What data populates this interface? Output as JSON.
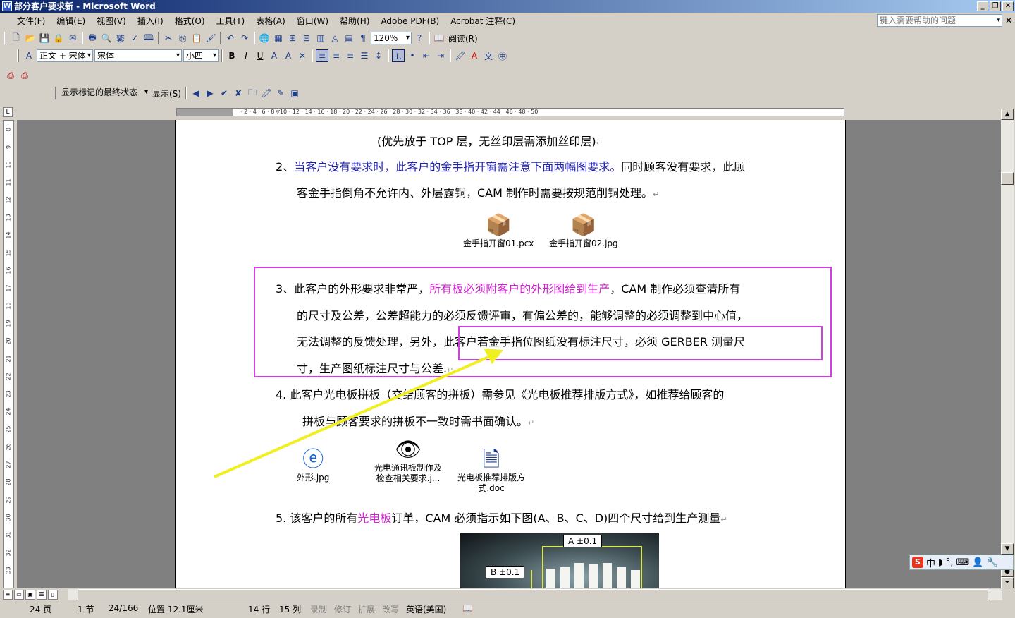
{
  "window": {
    "title": "部分客户要求新 - Microsoft Word"
  },
  "menu": {
    "items": [
      "文件(F)",
      "编辑(E)",
      "视图(V)",
      "插入(I)",
      "格式(O)",
      "工具(T)",
      "表格(A)",
      "窗口(W)",
      "帮助(H)",
      "Adobe PDF(B)",
      "Acrobat 注释(C)"
    ],
    "help_placeholder": "键入需要帮助的问题"
  },
  "toolbar": {
    "zoom": "120%",
    "read_label": "阅读(R)",
    "style": "正文 + 宋体",
    "font": "宋体",
    "size": "小四",
    "bold": "B",
    "italic": "I",
    "underline": "U",
    "font_color_label": "A",
    "review_state": "显示标记的最终状态",
    "show_label": "显示(S)"
  },
  "document": {
    "line_top": "(优先放于 TOP 层，无丝印层需添加丝印层)",
    "p2_num": "2、",
    "p2_blue": "当客户没有要求时，此客户的金手指开窗需注意下面两幅图要求。",
    "p2_rest": "同时顾客没有要求，此顾",
    "p2_line2": "客金手指倒角不允许内、外层露铜，CAM 制作时需要按规范削铜处理。",
    "attach1": "金手指开窗01.pcx",
    "attach2": "金手指开窗02.jpg",
    "p3_num": "3、",
    "p3_a": "此客户的外形要求非常严，",
    "p3_magenta": "所有板必须附客户的外形图给到生产",
    "p3_b": "，CAM 制作必须查清所有",
    "p3_line2": "的尺寸及公差，公差超能力的必须反馈评审，有偏公差的，能够调整的必须调整到中心值，",
    "p3_line3a": "无法调整的反馈处理，另外，",
    "p3_line3b": "此客户若金手指位图纸没有标注尺寸，必须 GERBER 测量尺",
    "p3_line4": "寸，生产图纸标注尺寸与公差.",
    "p4_num": "4.",
    "p4_line1": "此客户光电板拼板（交给顾客的拼板）需参见《光电板推荐排版方式》，如推荐给顾客的",
    "p4_line2": "拼板与顾客要求的拼板不一致时需书面确认。",
    "obj1": "外形.jpg",
    "obj2a": "光电通讯板制作及",
    "obj2b": "检查相关要求.j...",
    "obj3a": "光电板推荐排版方",
    "obj3b": "式.doc",
    "p5_num": "5.",
    "p5_a": "该客户的所有",
    "p5_magenta": "光电板",
    "p5_b": "订单，CAM 必须指示如下图(A、B、C、D)四个尺寸给到生产测量",
    "photo_label_a": "A ±0.1",
    "photo_label_b": "B ±0.1"
  },
  "status": {
    "page": "24 页",
    "section": "1 节",
    "page_of": "24/166",
    "position": "位置 12.1厘米",
    "line": "14 行",
    "column": "15 列",
    "rec": "录制",
    "trk": "修订",
    "ext": "扩展",
    "ovr": "改写",
    "language": "英语(美国)"
  },
  "colors": {
    "annotation_box": "#d040e0",
    "arrow": "#f0f020",
    "title_bar": "#0a246a",
    "blue_text": "#2020b0",
    "magenta_text": "#d020d0"
  }
}
